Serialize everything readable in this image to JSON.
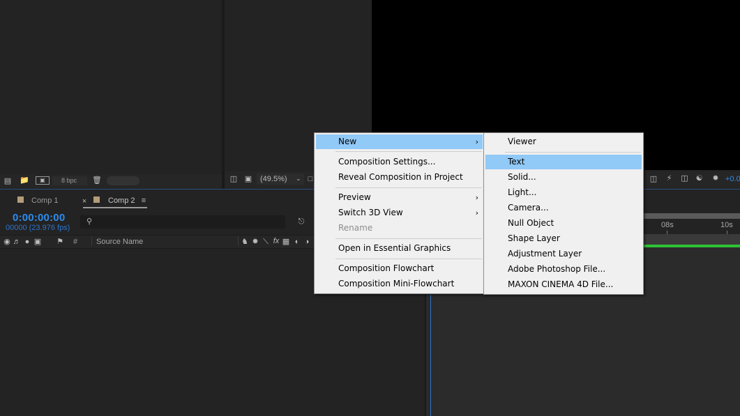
{
  "project_panel": {
    "bpc_label": "8 bpc"
  },
  "viewer": {
    "zoom_label": "(49.5%)",
    "exposure_label": "+0.0"
  },
  "timeline": {
    "tabs": [
      {
        "label": "Comp 1",
        "active": false
      },
      {
        "label": "Comp 2",
        "active": true
      }
    ],
    "timecode": "0:00:00:00",
    "fps_label": "00000 (23.976 fps)",
    "columns": {
      "hash": "#",
      "source_name": "Source Name"
    },
    "ruler": {
      "tick1": "08s",
      "tick2": "10s"
    }
  },
  "context_menu": {
    "items": [
      {
        "label": "New",
        "submenu": true,
        "highlighted": true
      },
      {
        "label": "Composition Settings..."
      },
      {
        "label": "Reveal Composition in Project"
      },
      {
        "label": "Preview",
        "submenu": true
      },
      {
        "label": "Switch 3D View",
        "submenu": true
      },
      {
        "label": "Rename",
        "disabled": true
      },
      {
        "label": "Open in Essential Graphics"
      },
      {
        "label": "Composition Flowchart"
      },
      {
        "label": "Composition Mini-Flowchart"
      }
    ]
  },
  "submenu_new": {
    "items": [
      {
        "label": "Viewer"
      },
      {
        "label": "Text",
        "highlighted": true
      },
      {
        "label": "Solid..."
      },
      {
        "label": "Light..."
      },
      {
        "label": "Camera..."
      },
      {
        "label": "Null Object"
      },
      {
        "label": "Shape Layer"
      },
      {
        "label": "Adjustment Layer"
      },
      {
        "label": "Adobe Photoshop File..."
      },
      {
        "label": "MAXON CINEMA 4D File..."
      }
    ]
  },
  "colors": {
    "highlight": "#91c9f7",
    "timecode_blue": "#2d8ceb",
    "label_tan": "#b49c7a",
    "green_bar": "#2ec235"
  },
  "icons": [
    "interpret-footage-icon",
    "folder-icon",
    "new-composition-icon",
    "trash-icon",
    "monitor-icon",
    "comp-mini-flowchart-icon",
    "eye-icon",
    "audio-icon",
    "solo-icon",
    "lock-icon",
    "label-icon",
    "search-icon"
  ]
}
